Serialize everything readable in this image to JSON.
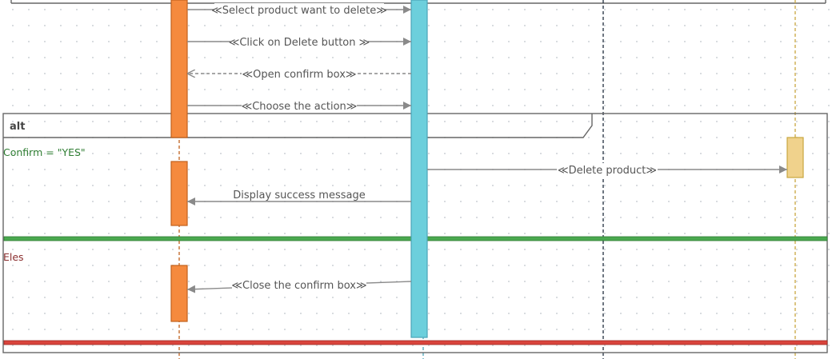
{
  "frame": {
    "operator": "alt",
    "guards": [
      {
        "text": "Confirm = \"YES\"",
        "color": "#2e7d32"
      },
      {
        "text": "Eles",
        "color": "#8b2f2f"
      }
    ]
  },
  "lifelines": [
    {
      "id": "user",
      "color": "#c0611d",
      "activation_fill": "#f58a3e"
    },
    {
      "id": "system",
      "color": "#4aa4b8",
      "activation_fill": "#6ccfdc"
    },
    {
      "id": "middle",
      "color": "#1f2d3d"
    },
    {
      "id": "database",
      "color": "#c9a640",
      "activation_fill": "#f0d28c"
    }
  ],
  "messages": [
    {
      "label": "≪Select product want to delete≫",
      "from": "user",
      "to": "system",
      "kind": "sync"
    },
    {
      "label": "≪Click on Delete button ≫",
      "from": "user",
      "to": "system",
      "kind": "sync"
    },
    {
      "label": "≪Open confirm box≫",
      "from": "system",
      "to": "user",
      "kind": "return"
    },
    {
      "label": "≪Choose the action≫",
      "from": "user",
      "to": "system",
      "kind": "sync"
    },
    {
      "label": "≪Delete product≫",
      "from": "system",
      "to": "database",
      "kind": "sync"
    },
    {
      "label": "Display success message",
      "from": "system",
      "to": "user",
      "kind": "sync"
    },
    {
      "label": "≪Close the confirm box≫",
      "from": "system",
      "to": "user",
      "kind": "sync"
    }
  ],
  "separator_colors": {
    "else": "#4aa94f",
    "end": "#d9443c"
  }
}
